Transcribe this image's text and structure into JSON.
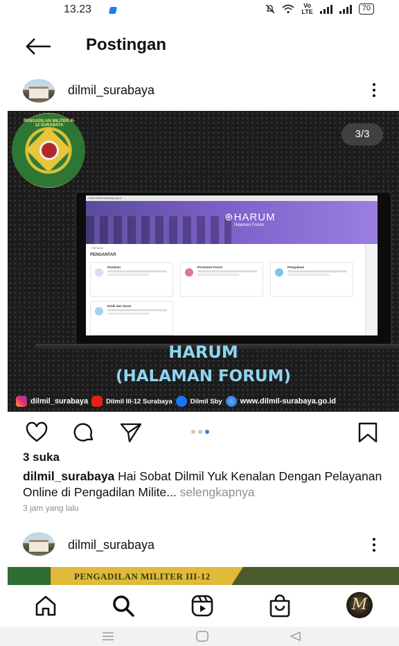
{
  "status_bar": {
    "time": "13.23",
    "volte": "Vo\nLTE",
    "battery": "70"
  },
  "header": {
    "title": "Postingan"
  },
  "post": {
    "username": "dilmil_surabaya",
    "counter": "3/3",
    "seal_text": "PENGADILAN MILITER III-12 SURABAYA",
    "screen": {
      "url_bar": "hdmil.dilmil-surabaya.go.id",
      "logo": "⊕HARUM",
      "logo_sub": "Halaman Forum",
      "breadcrumb": "⌂ Beranda",
      "section": "PENGANTAR",
      "cards": [
        "Panduan",
        "Peraturan Forum",
        "Pengaduan",
        "Kritik dan Saran"
      ]
    },
    "headline_1": "HARUM",
    "headline_2": "(HALAMAN FORUM)",
    "socials": {
      "instagram": "dilmil_surabaya",
      "youtube": "Dilmil III-12 Surabaya",
      "facebook": "Dilmil Sby",
      "website": "www.dilmil-surabaya.go.id"
    },
    "carousel": {
      "count": 3,
      "active": 3
    },
    "likes": "3 suka",
    "caption_user": "dilmil_surabaya",
    "caption_text": " Hai Sobat Dilmil Yuk Kenalan Dengan Pelayanan Online di Pengadilan Milite...",
    "caption_more": " selengkapnya",
    "time_ago": "3 jam yang lalu"
  },
  "next_post": {
    "username": "dilmil_surabaya",
    "banner_text": "PENGADILAN MILITER III-12"
  },
  "bottom_nav": {
    "icons": [
      "home-icon",
      "search-icon",
      "reels-icon",
      "shop-icon",
      "profile-avatar"
    ],
    "profile_initial": "M"
  },
  "colors": {
    "accent_blue": "#1e88e5",
    "headline": "#8fd6f2",
    "muted_text": "#8e8e8e"
  }
}
